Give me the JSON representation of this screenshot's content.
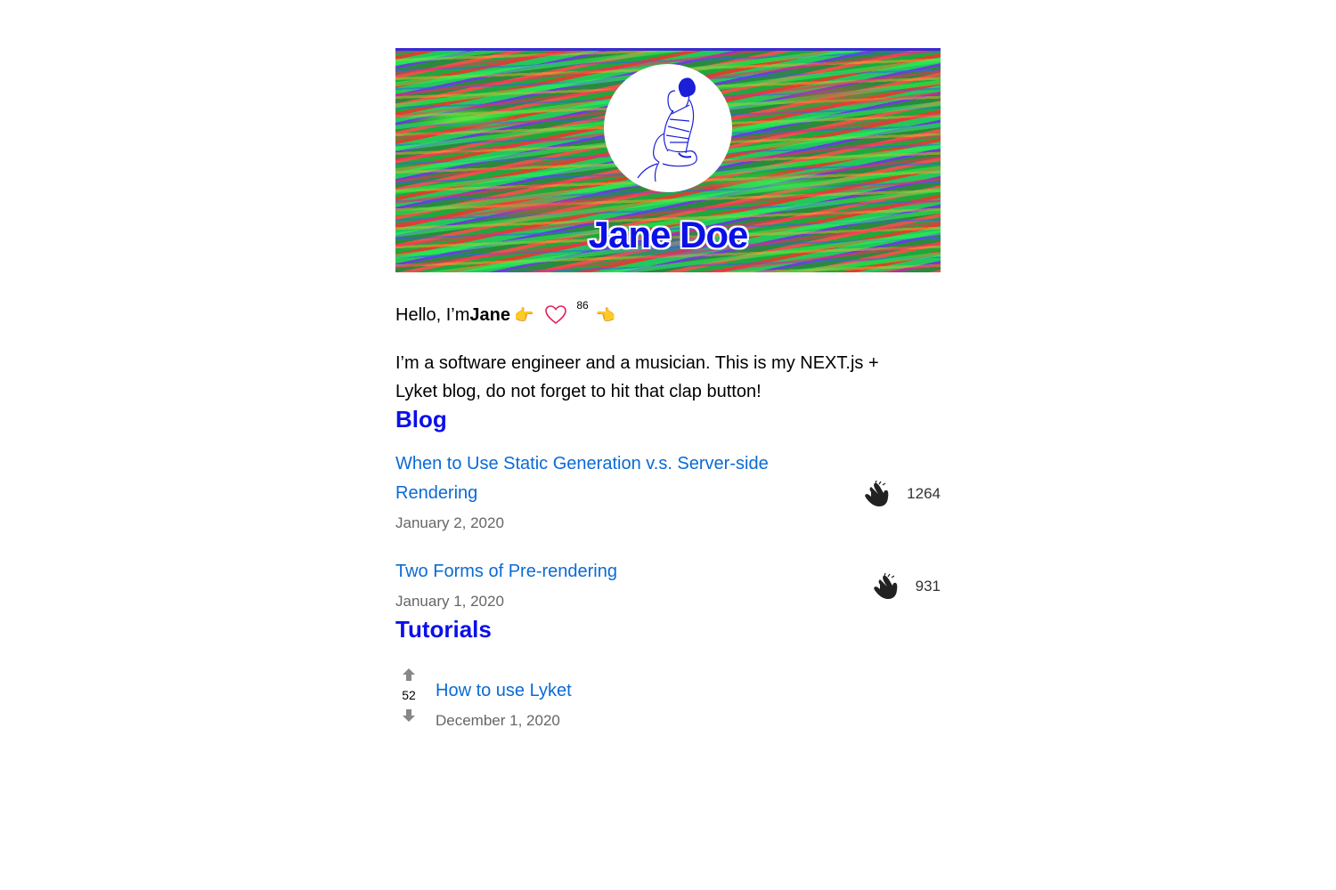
{
  "header": {
    "site_name": "Jane Doe",
    "avatar_alt": "profile illustration"
  },
  "intro": {
    "greeting_prefix": "Hello, I’m ",
    "greeting_name": "Jane",
    "pointer_right": "👉",
    "pointer_left": "👈",
    "heart_count": "86",
    "bio": "I’m a software engineer and a musician. This is my NEXT.js + Lyket blog, do not forget to hit that clap button!"
  },
  "blog": {
    "title": "Blog",
    "posts": [
      {
        "title": "When to Use Static Generation v.s. Server-side Rendering",
        "date": "January 2, 2020",
        "claps": "1264"
      },
      {
        "title": "Two Forms of Pre-rendering",
        "date": "January 1, 2020",
        "claps": "931"
      }
    ]
  },
  "tutorials": {
    "title": "Tutorials",
    "items": [
      {
        "title": "How to use Lyket",
        "date": "December 1, 2020",
        "votes": "52"
      }
    ]
  },
  "colors": {
    "heading": "#0b10e8",
    "link": "#0a6ad6",
    "date": "#666666",
    "heart": "#e0245e"
  }
}
